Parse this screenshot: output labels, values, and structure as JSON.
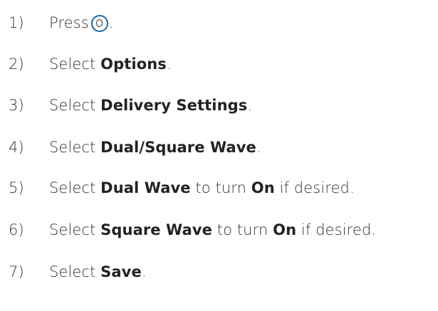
{
  "steps": [
    {
      "number": "1)",
      "parts": [
        {
          "text": "Press",
          "style": "light"
        },
        {
          "icon": "select-button-icon"
        },
        {
          "text": ".",
          "style": "light"
        }
      ]
    },
    {
      "number": "2)",
      "parts": [
        {
          "text": "Select ",
          "style": "light"
        },
        {
          "text": "Options",
          "style": "bold"
        },
        {
          "text": ".",
          "style": "light"
        }
      ]
    },
    {
      "number": "3)",
      "parts": [
        {
          "text": "Select ",
          "style": "light"
        },
        {
          "text": "Delivery Settings",
          "style": "bold"
        },
        {
          "text": ".",
          "style": "light"
        }
      ]
    },
    {
      "number": "4)",
      "parts": [
        {
          "text": "Select ",
          "style": "light"
        },
        {
          "text": "Dual/Square Wave",
          "style": "bold"
        },
        {
          "text": ".",
          "style": "light"
        }
      ]
    },
    {
      "number": "5)",
      "parts": [
        {
          "text": "Select ",
          "style": "light"
        },
        {
          "text": "Dual Wave",
          "style": "bold"
        },
        {
          "text": " to turn ",
          "style": "light"
        },
        {
          "text": "On",
          "style": "bold"
        },
        {
          "text": " if desired.",
          "style": "light"
        }
      ]
    },
    {
      "number": "6)",
      "parts": [
        {
          "text": "Select ",
          "style": "light"
        },
        {
          "text": "Square Wave",
          "style": "bold"
        },
        {
          "text": " to turn ",
          "style": "light"
        },
        {
          "text": "On",
          "style": "bold"
        },
        {
          "text": " if desired.",
          "style": "light"
        }
      ]
    },
    {
      "number": "7)",
      "parts": [
        {
          "text": "Select ",
          "style": "light"
        },
        {
          "text": "Save",
          "style": "bold"
        },
        {
          "text": ".",
          "style": "light"
        }
      ]
    }
  ],
  "colors": {
    "text": "#333333",
    "icon_ring": "#1f6aa5"
  }
}
